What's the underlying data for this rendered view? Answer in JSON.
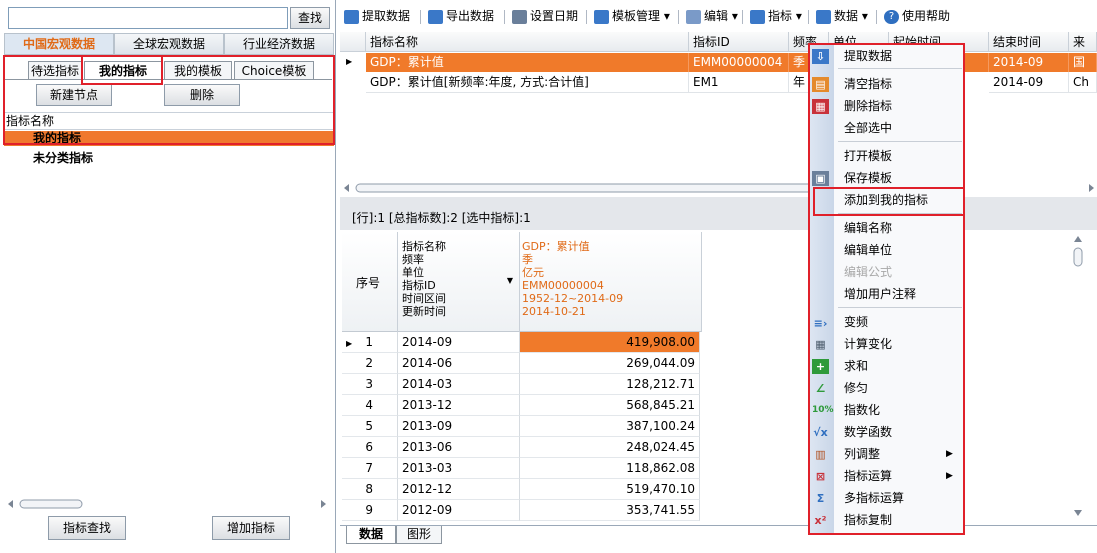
{
  "left": {
    "search": {
      "value": "",
      "button": "查找"
    },
    "category_tabs": [
      "中国宏观数据",
      "全球宏观数据",
      "行业经济数据"
    ],
    "sub_tabs": [
      "待选指标",
      "我的指标",
      "我的模板",
      "Choice模板"
    ],
    "new_node": "新建节点",
    "delete": "删除",
    "tree_header": "指标名称",
    "tree_items": [
      "我的指标",
      "未分类指标"
    ],
    "find_indicator": "指标查找",
    "add_indicator": "增加指标"
  },
  "toolbar": [
    {
      "label": "提取数据",
      "icon": "extract-icon",
      "color": "#3a78c8"
    },
    {
      "label": "导出数据",
      "icon": "export-icon",
      "color": "#3a78c8"
    },
    {
      "label": "设置日期",
      "icon": "calendar-icon",
      "color": "#6a7f9a"
    },
    {
      "label": "模板管理 ▾",
      "icon": "template-icon",
      "color": "#3a78c8"
    },
    {
      "label": "编辑 ▾",
      "icon": "edit-icon",
      "color": "#7a9ac8"
    },
    {
      "label": "指标 ▾",
      "icon": "function-icon",
      "color": "#3a78c8"
    },
    {
      "label": "数据 ▾",
      "icon": "data-icon",
      "color": "#3a78c8"
    },
    {
      "label": "使用帮助",
      "icon": "help-icon",
      "color": "#2f6fc0"
    }
  ],
  "grid": {
    "headers": [
      "指标名称",
      "指标ID",
      "频率",
      "单位",
      "起始时间",
      "结束时间",
      "来"
    ],
    "rows": [
      {
        "name": "GDP：累计值",
        "id": "EMM00000004",
        "freq": "季",
        "end": "2014-09",
        "src": "国"
      },
      {
        "name": "GDP：累计值[新频率:年度, 方式:合计值]",
        "id": "EM1",
        "freq": "年",
        "end": "2014-09",
        "src": "Ch"
      }
    ]
  },
  "status_bar": "[行]:1 [总指标数]:2 [选中指标]:1",
  "detail": {
    "seq_label": "序号",
    "field_labels": [
      "指标名称",
      "频率",
      "单位",
      "指标ID",
      "时间区间",
      "更新时间"
    ],
    "series_info": [
      "GDP：累计值",
      "季",
      "亿元",
      "EMM00000004",
      "1952-12~2014-09",
      "2014-10-21"
    ],
    "rows": [
      {
        "no": "1",
        "time": "2014-09",
        "value": "419,908.00"
      },
      {
        "no": "2",
        "time": "2014-06",
        "value": "269,044.09"
      },
      {
        "no": "3",
        "time": "2014-03",
        "value": "128,212.71"
      },
      {
        "no": "4",
        "time": "2013-12",
        "value": "568,845.21"
      },
      {
        "no": "5",
        "time": "2013-09",
        "value": "387,100.24"
      },
      {
        "no": "6",
        "time": "2013-06",
        "value": "248,024.45"
      },
      {
        "no": "7",
        "time": "2013-03",
        "value": "118,862.08"
      },
      {
        "no": "8",
        "time": "2012-12",
        "value": "519,470.10"
      },
      {
        "no": "9",
        "time": "2012-09",
        "value": "353,741.55"
      }
    ]
  },
  "bottom_tabs": [
    "数据",
    "图形"
  ],
  "context_menu": {
    "items": [
      "提取数据",
      "清空指标",
      "删除指标",
      "全部选中",
      "打开模板",
      "保存模板",
      "添加到我的指标",
      "编辑名称",
      "编辑单位",
      "编辑公式",
      "增加用户注释",
      "变频",
      "计算变化",
      "求和",
      "修匀",
      "指数化",
      "数学函数",
      "列调整",
      "指标运算",
      "多指标运算",
      "指标复制"
    ],
    "disabled_item": "编辑公式",
    "highlighted_item": "添加到我的指标"
  },
  "colors": {
    "accent": "#f07a2a",
    "annotation": "#e0202a",
    "tab_active_text": "#e06a17"
  }
}
